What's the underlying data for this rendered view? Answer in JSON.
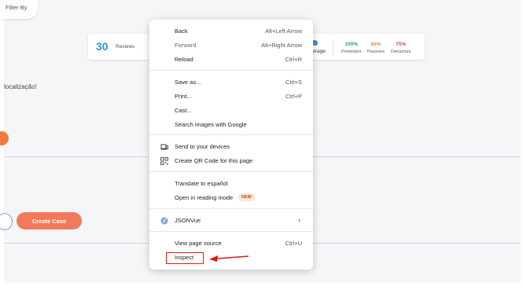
{
  "filter": {
    "label": "Filter By"
  },
  "stats": {
    "reviews_count": "30",
    "reviews_label": "Reviews",
    "average_label": "verage",
    "promoters_pct": "100%",
    "promoters_label": "Promoters",
    "passives_pct": "86%",
    "passives_label": "Passives",
    "detractors_pct": "75%",
    "detractors_label": "Detractors"
  },
  "content": {
    "row_text": "localização!",
    "create_case_label": "Create Case"
  },
  "context_menu": {
    "back": {
      "label": "Back",
      "shortcut": "Alt+Left Arrow"
    },
    "forward": {
      "label": "Forward",
      "shortcut": "Alt+Right Arrow"
    },
    "reload": {
      "label": "Reload",
      "shortcut": "Ctrl+R"
    },
    "save_as": {
      "label": "Save as...",
      "shortcut": "Ctrl+S"
    },
    "print": {
      "label": "Print...",
      "shortcut": "Ctrl+P"
    },
    "cast": {
      "label": "Cast..."
    },
    "search_images": {
      "label": "Search images with Google"
    },
    "send_devices": {
      "label": "Send to your devices",
      "icon": "devices-icon"
    },
    "qr_code": {
      "label": "Create QR Code for this page",
      "icon": "qr-code-icon"
    },
    "translate": {
      "label": "Translate to español"
    },
    "reading_mode": {
      "label": "Open in reading mode",
      "badge": "NEW"
    },
    "jsonvue": {
      "label": "JSONVue",
      "icon": "jsonvue-icon"
    },
    "view_source": {
      "label": "View page source",
      "shortcut": "Ctrl+U"
    },
    "inspect": {
      "label": "Inspect"
    }
  },
  "colors": {
    "accent_blue": "#2d8fd5",
    "promoters": "#3aa34a",
    "passives": "#f08a3c",
    "detractors": "#e04848",
    "button_orange": "#f27a5a",
    "highlight_red": "#e01818"
  }
}
